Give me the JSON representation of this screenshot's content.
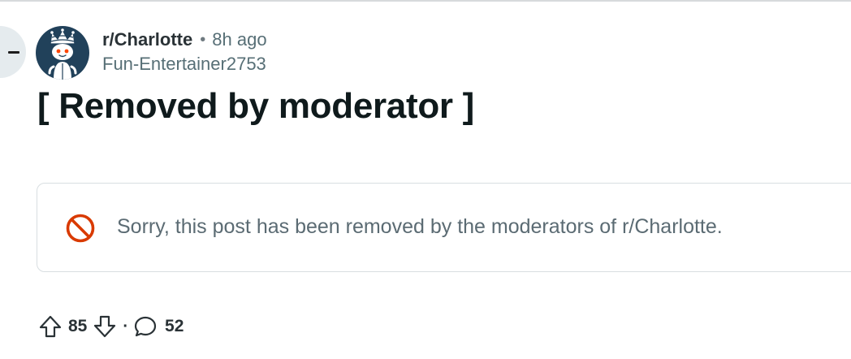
{
  "post": {
    "subreddit": "r/Charlotte",
    "separator": "•",
    "age": "8h ago",
    "author": "Fun-Entertainer2753",
    "title": "[ Removed by moderator ]"
  },
  "removal_notice": {
    "message": "Sorry, this post has been removed by the moderators of r/Charlotte.",
    "icon": "prohibited-icon",
    "icon_color": "#d93a00"
  },
  "actions": {
    "upvote_icon": "upvote-icon",
    "vote_count": "85",
    "downvote_icon": "downvote-icon",
    "separator": "·",
    "comment_icon": "comment-icon",
    "comment_count": "52"
  },
  "colors": {
    "avatar_bg": "#21415a",
    "text_primary": "#0f1a1c",
    "text_secondary": "#576f76"
  }
}
